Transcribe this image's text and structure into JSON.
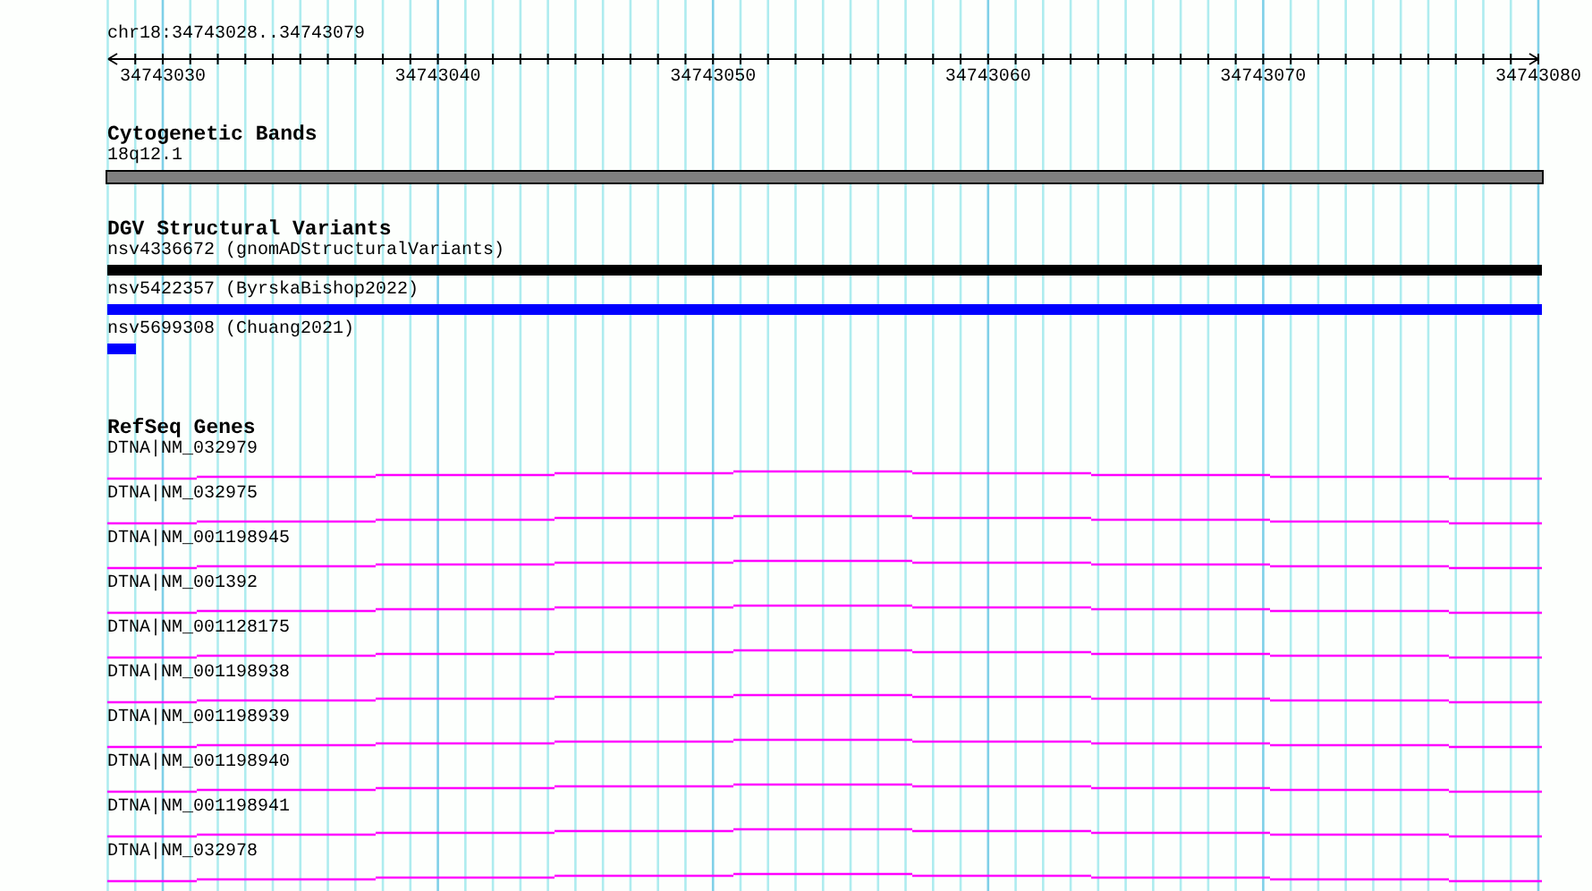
{
  "ruler": {
    "region": "chr18:34743028..34743079",
    "labels": [
      "34743030",
      "34743040",
      "34743050",
      "34743060",
      "34743070",
      "34743080"
    ]
  },
  "tracks": [
    {
      "kind": "bands",
      "title": "Cytogenetic Bands",
      "features": [
        {
          "label": "18q12.1",
          "color": "#808080"
        }
      ]
    },
    {
      "kind": "variants",
      "title": "DGV Structural Variants",
      "features": [
        {
          "label": "nsv4336672 (gnomADStructuralVariants)",
          "color": "#000000"
        },
        {
          "label": "nsv5422357 (ByrskaBishop2022)",
          "color": "#0000ff"
        },
        {
          "label": "nsv5699308 (Chuang2021)",
          "color": "#0000ff",
          "level": 0.02
        }
      ]
    },
    {
      "kind": "genes",
      "title": "RefSeq Genes",
      "features": [
        {
          "label": "DTNA|NM_032979"
        },
        {
          "label": "DTNA|NM_032975"
        },
        {
          "label": "DTNA|NM_001198945"
        },
        {
          "label": "DTNA|NM_001392"
        },
        {
          "label": "DTNA|NM_001128175"
        },
        {
          "label": "DTNA|NM_001198938"
        },
        {
          "label": "DTNA|NM_001198939"
        },
        {
          "label": "DTNA|NM_001198940"
        },
        {
          "label": "DTNA|NM_001198941"
        },
        {
          "label": "DTNA|NM_032978"
        }
      ]
    }
  ]
}
